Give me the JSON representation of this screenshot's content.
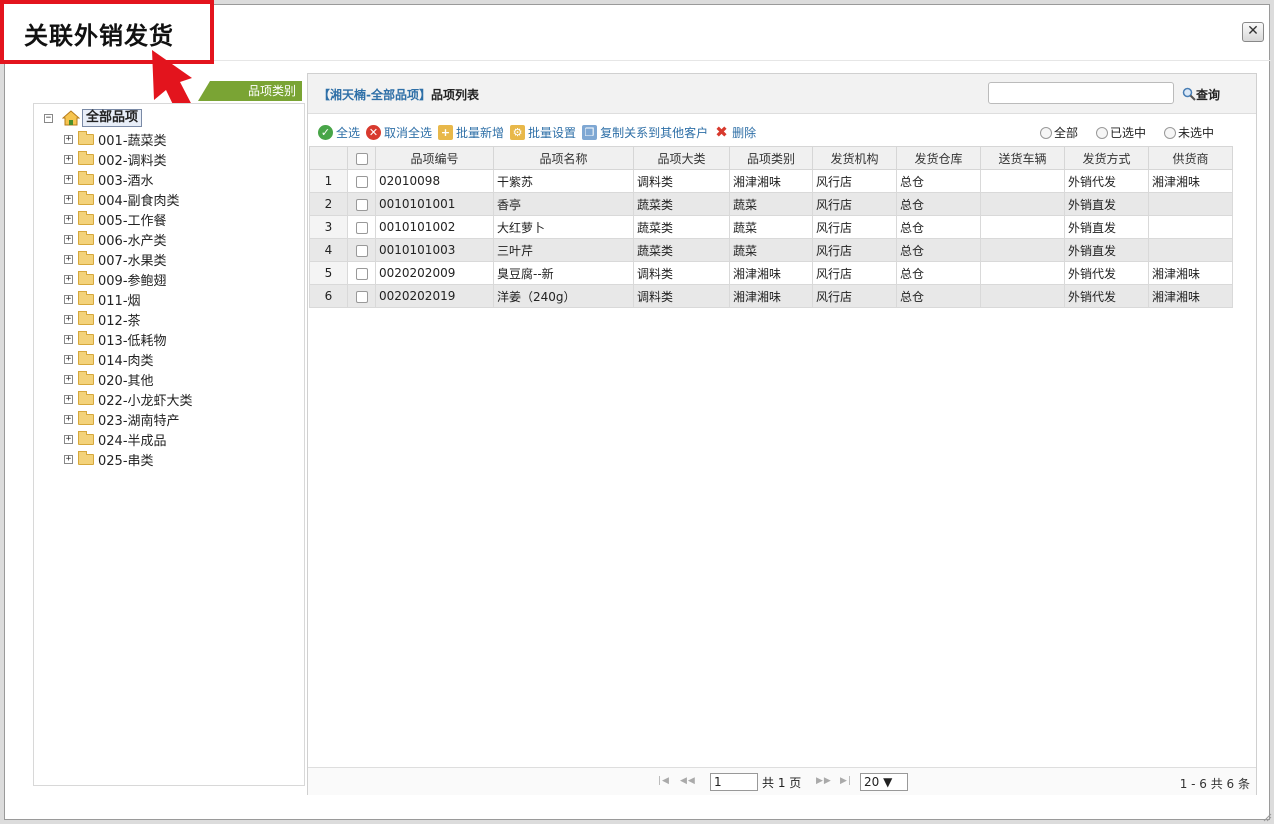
{
  "dialog": {
    "title": "关联外销发货",
    "close_label": "✕"
  },
  "tree": {
    "tag_label": "品项类别",
    "root_label": "全部品项",
    "nodes": [
      {
        "label": "001-蔬菜类"
      },
      {
        "label": "002-调料类"
      },
      {
        "label": "003-酒水"
      },
      {
        "label": "004-副食肉类"
      },
      {
        "label": "005-工作餐"
      },
      {
        "label": "006-水产类"
      },
      {
        "label": "007-水果类"
      },
      {
        "label": "009-参鲍翅"
      },
      {
        "label": "011-烟"
      },
      {
        "label": "012-茶"
      },
      {
        "label": "013-低耗物"
      },
      {
        "label": "014-肉类"
      },
      {
        "label": "020-其他"
      },
      {
        "label": "022-小龙虾大类"
      },
      {
        "label": "023-湖南特产"
      },
      {
        "label": "024-半成品"
      },
      {
        "label": "025-串类"
      }
    ]
  },
  "list": {
    "org_label": "【湘天楠-全部品项】",
    "title": "品项列表",
    "search_value": "",
    "search_label": "查询",
    "toolbar": {
      "select_all": "全选",
      "deselect_all": "取消全选",
      "batch_add": "批量新增",
      "batch_set": "批量设置",
      "copy_relation": "复制关系到其他客户",
      "delete": "删除"
    },
    "filters": {
      "all": "全部",
      "selected": "已选中",
      "unselected": "未选中"
    },
    "columns": [
      "品项编号",
      "品项名称",
      "品项大类",
      "品项类别",
      "发货机构",
      "发货仓库",
      "送货车辆",
      "发货方式",
      "供货商"
    ],
    "rows": [
      {
        "n": "1",
        "code": "02010098",
        "name": "干紫苏",
        "cat": "调料类",
        "type": "湘津湘味",
        "org": "风行店",
        "wh": "总仓",
        "car": "",
        "mode": "外销代发",
        "supplier": "湘津湘味"
      },
      {
        "n": "2",
        "code": "0010101001",
        "name": "香亭",
        "cat": "蔬菜类",
        "type": "蔬菜",
        "org": "风行店",
        "wh": "总仓",
        "car": "",
        "mode": "外销直发",
        "supplier": ""
      },
      {
        "n": "3",
        "code": "0010101002",
        "name": "大红萝卜",
        "cat": "蔬菜类",
        "type": "蔬菜",
        "org": "风行店",
        "wh": "总仓",
        "car": "",
        "mode": "外销直发",
        "supplier": ""
      },
      {
        "n": "4",
        "code": "0010101003",
        "name": "三叶芹",
        "cat": "蔬菜类",
        "type": "蔬菜",
        "org": "风行店",
        "wh": "总仓",
        "car": "",
        "mode": "外销直发",
        "supplier": ""
      },
      {
        "n": "5",
        "code": "0020202009",
        "name": "臭豆腐--新",
        "cat": "调料类",
        "type": "湘津湘味",
        "org": "风行店",
        "wh": "总仓",
        "car": "",
        "mode": "外销代发",
        "supplier": "湘津湘味"
      },
      {
        "n": "6",
        "code": "0020202019",
        "name": "洋姜（240g）",
        "cat": "调料类",
        "type": "湘津湘味",
        "org": "风行店",
        "wh": "总仓",
        "car": "",
        "mode": "外销代发",
        "supplier": "湘津湘味"
      }
    ]
  },
  "pager": {
    "first": "|◀",
    "prev": "◀◀",
    "page_value": "1",
    "total_pages": "共 1 页",
    "next": "▶▶",
    "last": "▶|",
    "page_size": "20 ▼",
    "info": "1 - 6   共 6 条"
  },
  "colors": {
    "highlight": "#e3141d",
    "tag_green": "#7aa434",
    "link_blue": "#2e6fa7"
  }
}
